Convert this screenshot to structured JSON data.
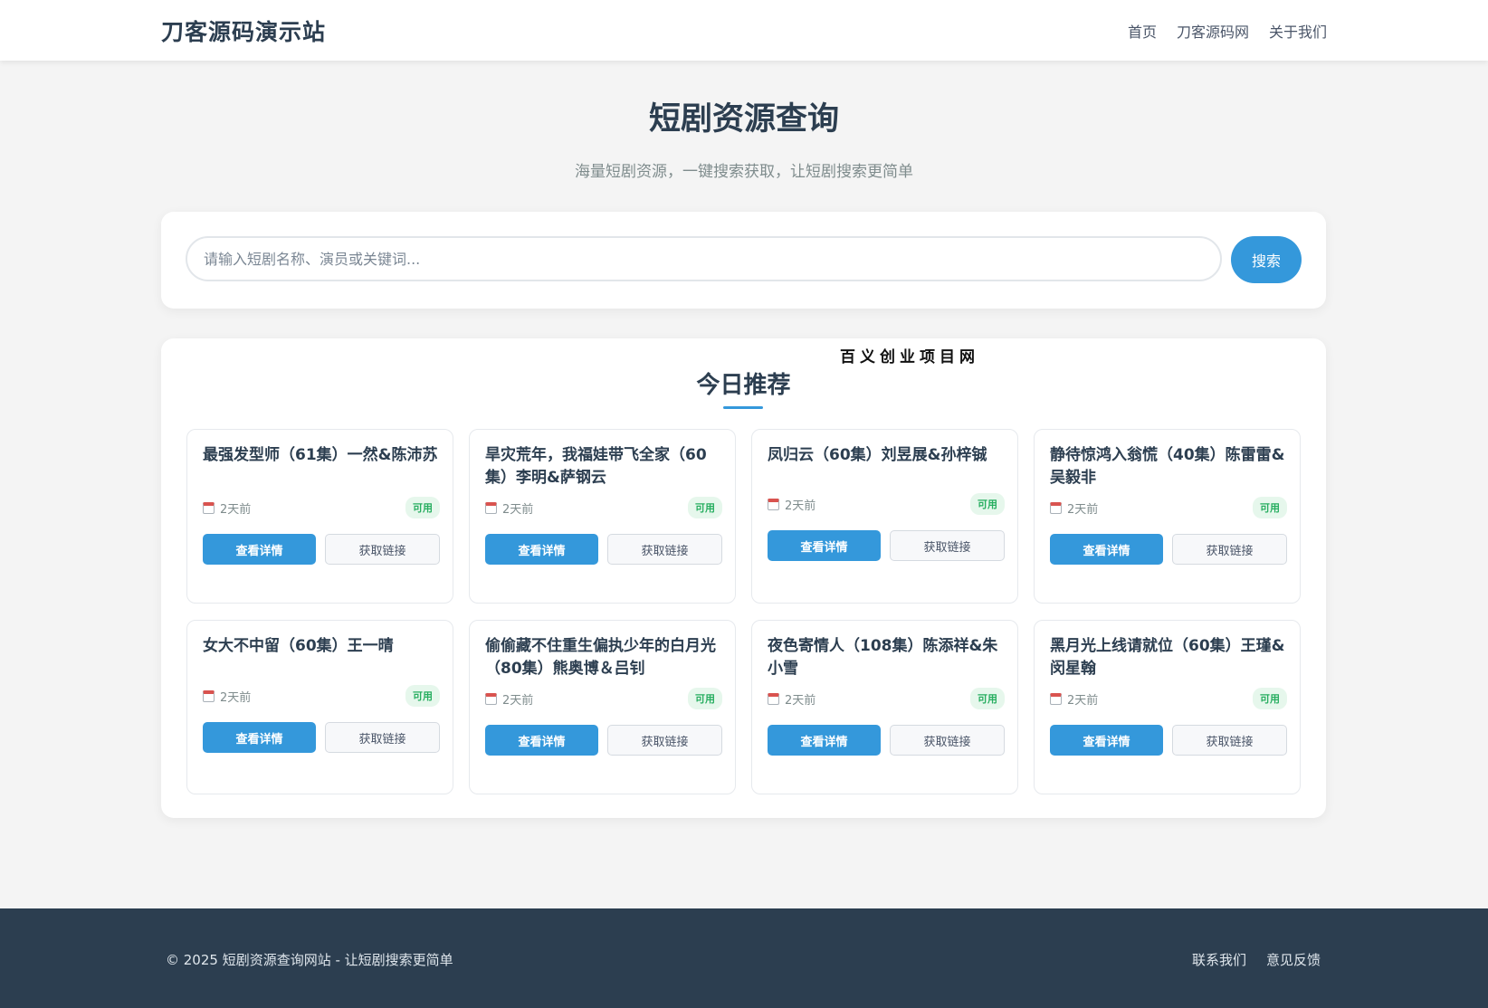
{
  "header": {
    "brand": "刀客源码演示站",
    "nav": [
      "首页",
      "刀客源码网",
      "关于我们"
    ]
  },
  "hero": {
    "title": "短剧资源查询",
    "subtitle": "海量短剧资源，一键搜索获取，让短剧搜索更简单"
  },
  "search": {
    "placeholder": "请输入短剧名称、演员或关键词...",
    "value": "",
    "button": "搜索"
  },
  "recommend": {
    "watermark": "百义创业项目网",
    "title": "今日推荐",
    "cards": [
      {
        "title": "最强发型师（61集）一然&陈沛苏",
        "date": "2天前",
        "status": "可用",
        "detail": "查看详情",
        "link": "获取链接"
      },
      {
        "title": "旱灾荒年，我福娃带飞全家（60集）李明&萨钢云",
        "date": "2天前",
        "status": "可用",
        "detail": "查看详情",
        "link": "获取链接"
      },
      {
        "title": "凤归云（60集）刘昱展&孙梓铖",
        "date": "2天前",
        "status": "可用",
        "detail": "查看详情",
        "link": "获取链接"
      },
      {
        "title": "静待惊鸿入翁慌（40集）陈雷雷&吴毅非",
        "date": "2天前",
        "status": "可用",
        "detail": "查看详情",
        "link": "获取链接"
      },
      {
        "title": "女大不中留（60集）王一晴",
        "date": "2天前",
        "status": "可用",
        "detail": "查看详情",
        "link": "获取链接"
      },
      {
        "title": "偷偷藏不住重生偏执少年的白月光（80集）熊奥博＆吕钊",
        "date": "2天前",
        "status": "可用",
        "detail": "查看详情",
        "link": "获取链接"
      },
      {
        "title": "夜色寄情人（108集）陈添祥&朱小雪",
        "date": "2天前",
        "status": "可用",
        "detail": "查看详情",
        "link": "获取链接"
      },
      {
        "title": "黑月光上线请就位（60集）王瑾&闵星翰",
        "date": "2天前",
        "status": "可用",
        "detail": "查看详情",
        "link": "获取链接"
      }
    ]
  },
  "footer": {
    "copyright": "© 2025 短剧资源查询网站 - 让短剧搜索更简单",
    "links": [
      "联系我们",
      "意见反馈"
    ]
  },
  "colors": {
    "accent": "#3498db",
    "heading": "#2c3e50",
    "footer_bg": "#2c3e50",
    "badge_text": "#27ae60",
    "badge_bg": "#e6f7ec"
  },
  "icons": {
    "card_date_icon": "calendar-icon"
  }
}
